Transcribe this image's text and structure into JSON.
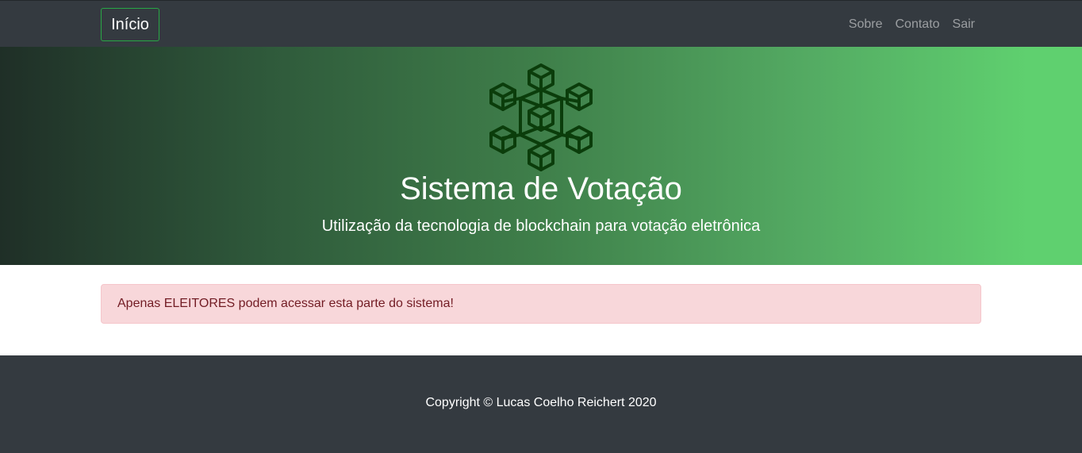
{
  "navbar": {
    "brand": "Início",
    "links": [
      "Sobre",
      "Contato",
      "Sair"
    ]
  },
  "hero": {
    "logo_icon": "blockchain-cubes-icon",
    "title": "Sistema de Votação",
    "subtitle": "Utilização da tecnologia de blockchain para votação eletrônica"
  },
  "alert": {
    "message": "Apenas ELEITORES podem acessar esta parte do sistema!"
  },
  "footer": {
    "copyright": "Copyright © Lucas Coelho Reichert 2020"
  },
  "colors": {
    "navbar_bg": "#343a40",
    "brand_border": "#28a745",
    "hero_gradient_start": "#1f2f27",
    "hero_gradient_end": "#5fd06f",
    "alert_bg": "#f8d7da",
    "alert_text": "#721c24",
    "logo_stroke": "#0b3d0b"
  }
}
